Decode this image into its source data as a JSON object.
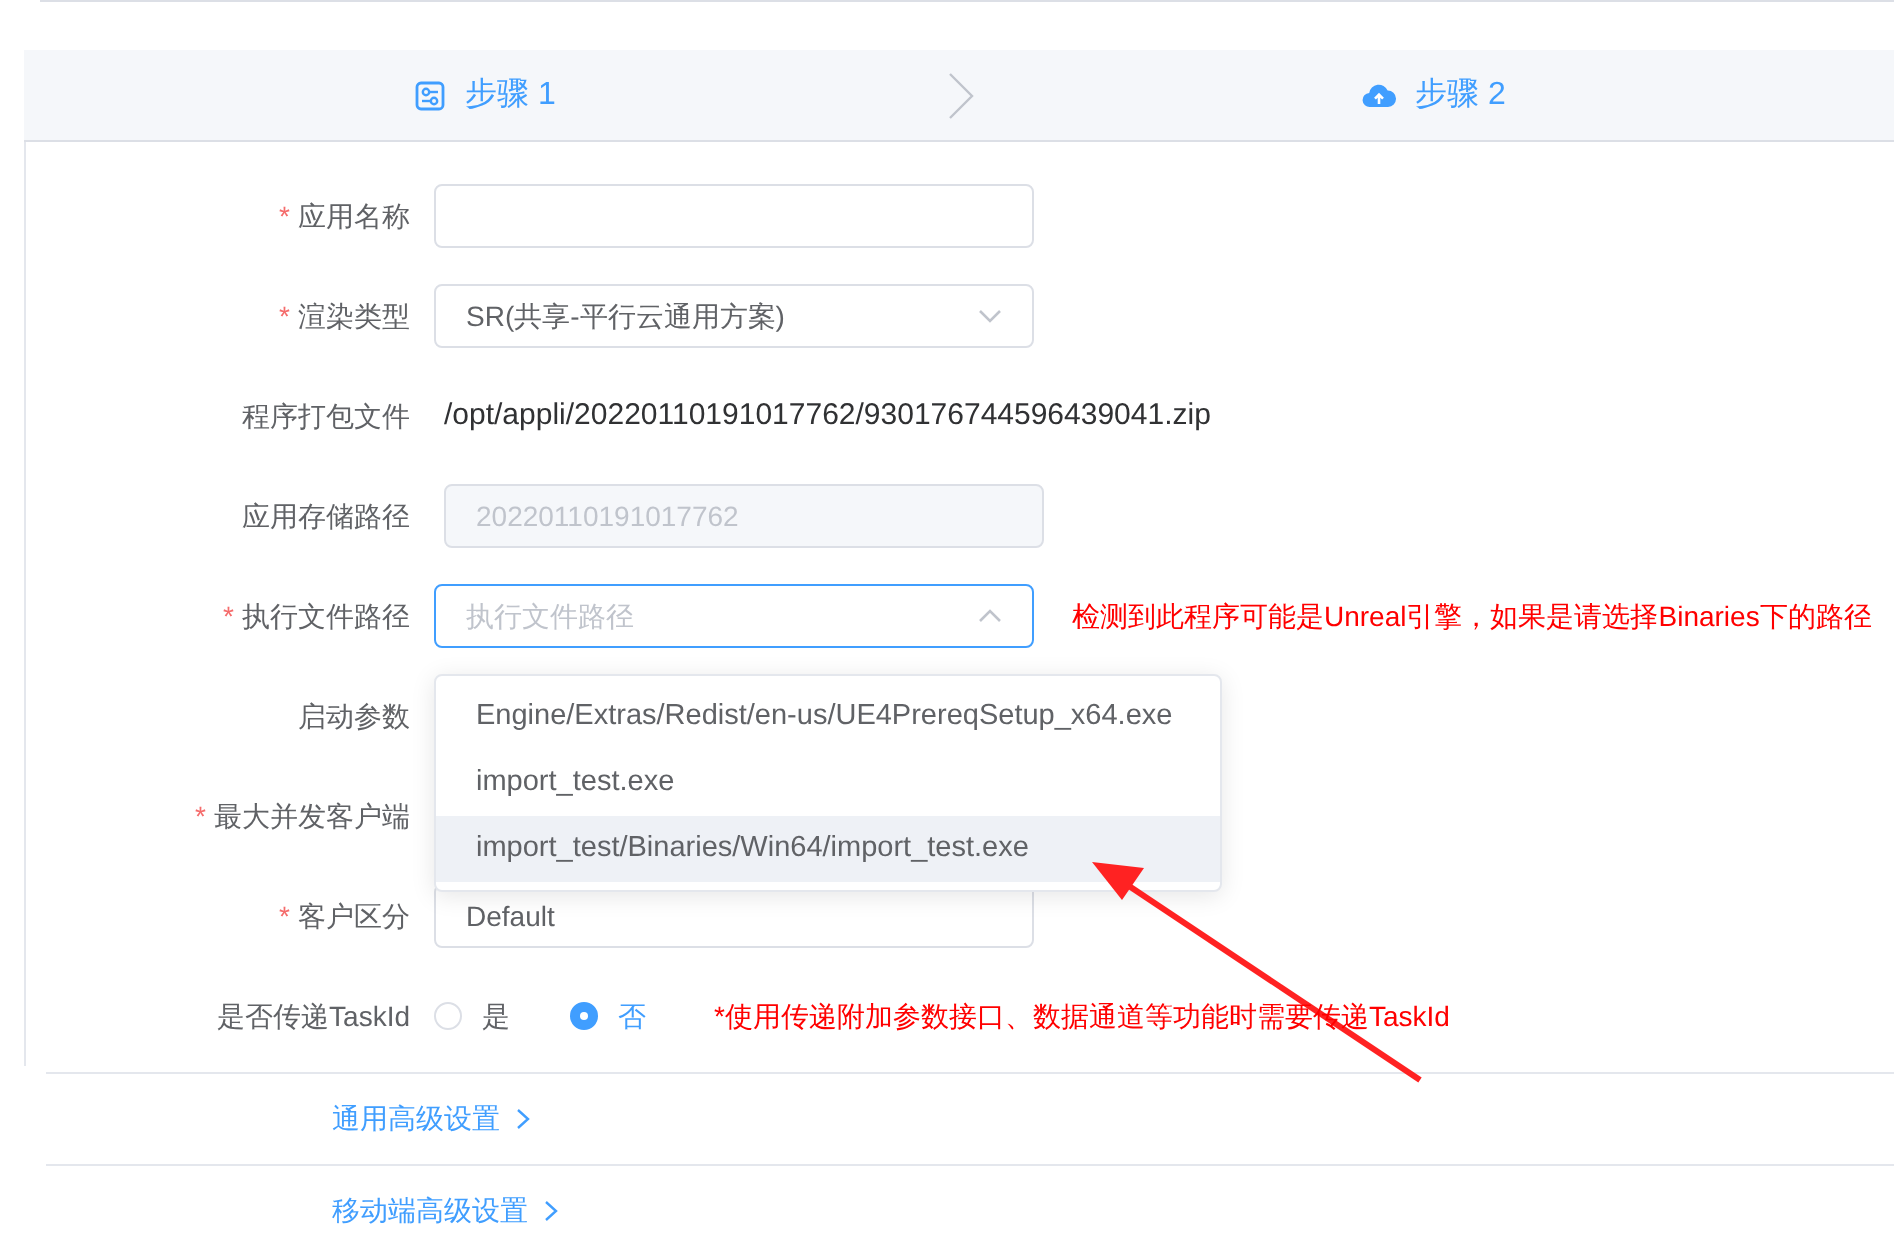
{
  "steps": [
    {
      "label": "步骤 1"
    },
    {
      "label": "步骤 2"
    }
  ],
  "form": [
    {
      "label": "应用名称",
      "marker": "*",
      "kind": "input"
    },
    {
      "label": "渲染类型",
      "marker": "*",
      "kind": "select",
      "value": "SR(共享-平行云通用方案)"
    },
    {
      "label": "程序打包文件",
      "kind": "text",
      "value": "/opt/appli/20220110191017762/930176744596439041.zip"
    },
    {
      "label": "应用存储路径",
      "kind": "disabled",
      "value": "20220110191017762"
    },
    {
      "label": "执行文件路径",
      "marker": "*",
      "kind": "dropdown",
      "placeholder": "执行文件路径",
      "hint": "检测到此程序可能是Unreal引擎，如果是请选择Binaries下的路径",
      "options": [
        {
          "label": "Engine/Extras/Redist/en-us/UE4PrereqSetup_x64.exe",
          "hovered": false
        },
        {
          "label": "import_test.exe",
          "hovered": false
        },
        {
          "label": "import_test/Binaries/Win64/import_test.exe",
          "hovered": true
        }
      ]
    },
    {
      "label": "启动参数",
      "kind": "covered"
    },
    {
      "label": "最大并发客户端",
      "marker": "*",
      "kind": "covered"
    },
    {
      "label": "客户区分",
      "marker": "*",
      "kind": "input",
      "value": "Default"
    },
    {
      "label": "是否传递TaskId",
      "kind": "radio",
      "options": [
        {
          "label": "是",
          "selected": false
        },
        {
          "label": "否",
          "selected": true
        }
      ],
      "note": "*使用传递附加参数接口、数据通道等功能时需要传递TaskId"
    }
  ],
  "sections": [
    {
      "label": "通用高级设置"
    },
    {
      "label": "移动端高级设置"
    }
  ]
}
